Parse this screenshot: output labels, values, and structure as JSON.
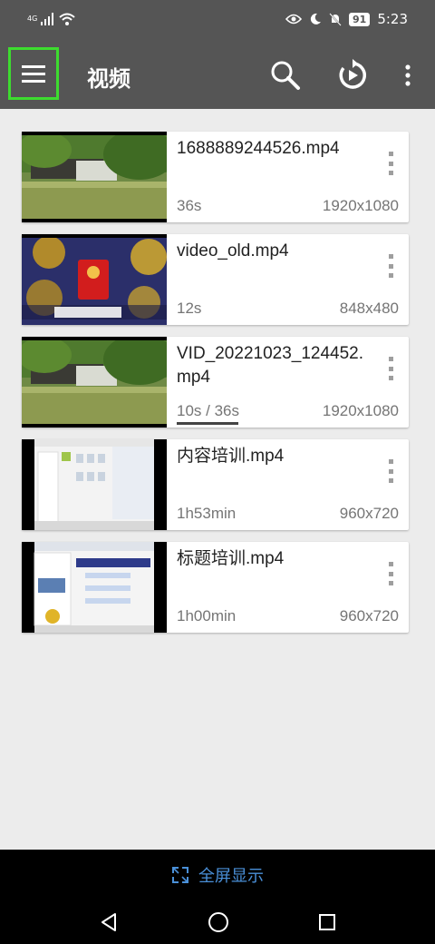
{
  "status_bar": {
    "network": "4G",
    "time": "5:23",
    "battery": "91"
  },
  "app_bar": {
    "title": "视频"
  },
  "videos": [
    {
      "name": "1688889244526.mp4",
      "duration": "36s",
      "resolution": "1920x1080",
      "thumb": "park-scene"
    },
    {
      "name": "video_old.mp4",
      "duration": "12s",
      "resolution": "848x480",
      "thumb": "red-envelope-ad"
    },
    {
      "name": "VID_20221023_124452.mp4",
      "duration": "10s / 36s",
      "resolution": "1920x1080",
      "thumb": "park-scene",
      "progress": 0.28
    },
    {
      "name": "内容培训.mp4",
      "duration": "1h53min",
      "resolution": "960x720",
      "thumb": "screen-recording"
    },
    {
      "name": "标题培训.mp4",
      "duration": "1h00min",
      "resolution": "960x720",
      "thumb": "screen-recording-2"
    }
  ],
  "fullscreen_button": {
    "label": "全屏显示"
  },
  "colors": {
    "bar": "#555555",
    "background": "#ececec",
    "highlight": "#3ddc2f",
    "accent": "#4a90d9"
  }
}
